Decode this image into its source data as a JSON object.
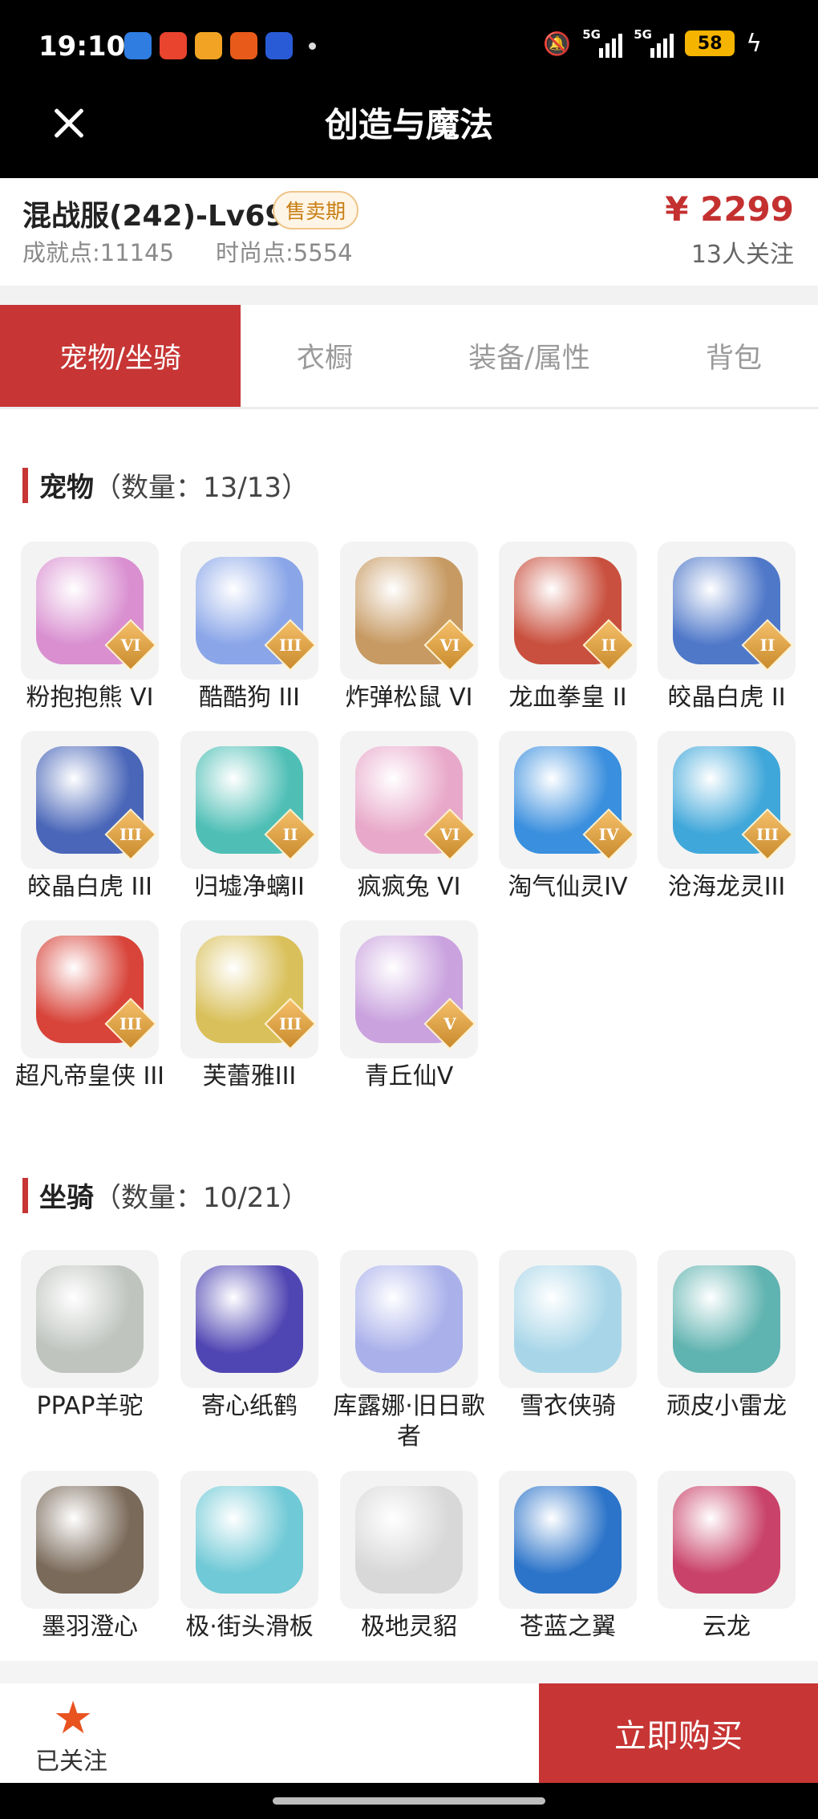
{
  "status": {
    "time": "19:10",
    "net1": "5G",
    "net2": "5G",
    "battery": "58",
    "apps": [
      {
        "icon": "wallet-app-icon",
        "color": "#2f7de1"
      },
      {
        "icon": "video-app-icon",
        "color": "#e8442e"
      },
      {
        "icon": "weibo-app-icon",
        "color": "#f2a324"
      },
      {
        "icon": "shopping-app-icon",
        "color": "#e85a1a"
      },
      {
        "icon": "browser-app-icon",
        "color": "#2a5bd7"
      }
    ]
  },
  "nav": {
    "title": "创造与魔法"
  },
  "info": {
    "server": "混战服(242)-Lv69",
    "badge": "售卖期",
    "achievement": "成就点:11145",
    "fashion": "时尚点:5554",
    "price": "¥ 2299",
    "followers": "13人关注"
  },
  "tabs": [
    {
      "label": "宠物/坐骑",
      "active": true
    },
    {
      "label": "衣橱",
      "active": false
    },
    {
      "label": "装备/属性",
      "active": false
    },
    {
      "label": "背包",
      "active": false
    }
  ],
  "pets": {
    "title": "宠物",
    "count": "（数量：13/13）",
    "items": [
      {
        "label": "粉抱抱熊 VI",
        "rank": "VI",
        "color": "#d98fd0"
      },
      {
        "label": "酷酷狗 III",
        "rank": "III",
        "color": "#8aa6e8"
      },
      {
        "label": "炸弹松鼠 VI",
        "rank": "VI",
        "color": "#c79a63"
      },
      {
        "label": "龙血拳皇 II",
        "rank": "II",
        "color": "#c9503e"
      },
      {
        "label": "皎晶白虎 II",
        "rank": "II",
        "color": "#4f78c9"
      },
      {
        "label": "皎晶白虎 III",
        "rank": "III",
        "color": "#4966b8"
      },
      {
        "label": "归墟净螭II",
        "rank": "II",
        "color": "#4fbfb6"
      },
      {
        "label": "疯疯兔 VI",
        "rank": "VI",
        "color": "#e8a8c9"
      },
      {
        "label": "淘气仙灵IV",
        "rank": "IV",
        "color": "#3a8fde"
      },
      {
        "label": "沧海龙灵III",
        "rank": "III",
        "color": "#3fa7d9"
      },
      {
        "label": "超凡帝皇侠 III",
        "rank": "III",
        "color": "#d8443a"
      },
      {
        "label": "芙蕾雅III",
        "rank": "III",
        "color": "#d9c05a"
      },
      {
        "label": "青丘仙V",
        "rank": "V",
        "color": "#c9a2de"
      }
    ]
  },
  "mounts": {
    "title": "坐骑",
    "count": "（数量：10/21）",
    "items": [
      {
        "label": "PPAP羊驼",
        "color": "#bfc4bf"
      },
      {
        "label": "寄心纸鹤",
        "color": "#5046b3"
      },
      {
        "label": "库露娜·旧日歌者",
        "color": "#a9b0ea"
      },
      {
        "label": "雪衣侠骑",
        "color": "#a8d6e8"
      },
      {
        "label": "顽皮小雷龙",
        "color": "#5fb3b0"
      },
      {
        "label": "墨羽澄心",
        "color": "#7a6a5a"
      },
      {
        "label": "极·街头滑板",
        "color": "#6fc9d6"
      },
      {
        "label": "极地灵貂",
        "color": "#d8d8d8"
      },
      {
        "label": "苍蓝之翼",
        "color": "#2c74c9"
      },
      {
        "label": "云龙",
        "color": "#c9426a"
      }
    ]
  },
  "footer": {
    "follow_label": "已关注",
    "buy_label": "立即购买"
  }
}
